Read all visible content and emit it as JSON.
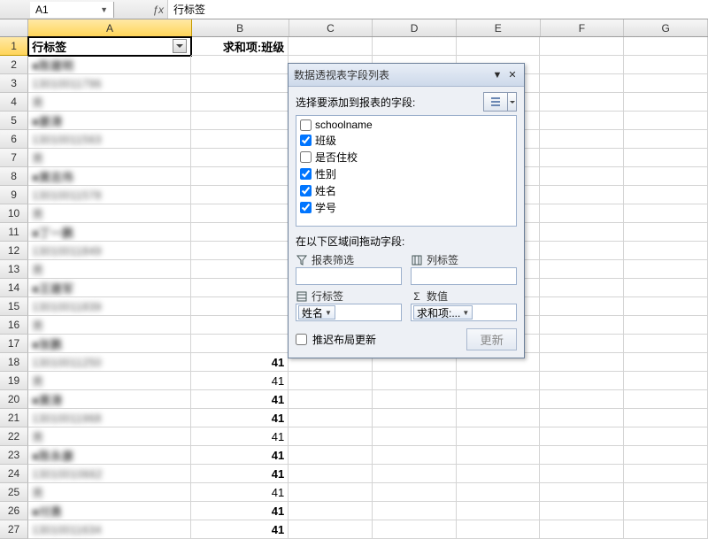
{
  "namebox": "A1",
  "formula": "行标签",
  "columns": [
    "A",
    "B",
    "C",
    "D",
    "E",
    "F",
    "G"
  ],
  "colWidths": {
    "A": 195,
    "B": 116,
    "C": 100,
    "D": 100,
    "E": 100,
    "F": 100,
    "G": 100
  },
  "rows": [
    {
      "n": 1,
      "a": "行标签",
      "aBold": true,
      "dd": true,
      "b": "求和项:班级",
      "bBold": true,
      "active": true
    },
    {
      "n": 2,
      "a": "■陈建明",
      "blur": true,
      "bold": true
    },
    {
      "n": 3,
      "a": "   13010011796",
      "blur": true
    },
    {
      "n": 4,
      "a": "      男",
      "blur": true
    },
    {
      "n": 5,
      "a": "■姜涛",
      "blur": true,
      "bold": true
    },
    {
      "n": 6,
      "a": "   13010011563",
      "blur": true
    },
    {
      "n": 7,
      "a": "      男",
      "blur": true
    },
    {
      "n": 8,
      "a": "■黄志伟",
      "blur": true,
      "bold": true
    },
    {
      "n": 9,
      "a": "   13010011578",
      "blur": true
    },
    {
      "n": 10,
      "a": "      男",
      "blur": true
    },
    {
      "n": 11,
      "a": "■丁一鹏",
      "blur": true,
      "bold": true
    },
    {
      "n": 12,
      "a": "   13010011849",
      "blur": true
    },
    {
      "n": 13,
      "a": "      男",
      "blur": true
    },
    {
      "n": 14,
      "a": "■王建军",
      "blur": true,
      "bold": true
    },
    {
      "n": 15,
      "a": "   13010011839",
      "blur": true
    },
    {
      "n": 16,
      "a": "      男",
      "blur": true
    },
    {
      "n": 17,
      "a": "■张鹏",
      "blur": true,
      "bold": true
    },
    {
      "n": 18,
      "a": "   13010011250",
      "blur": true,
      "b": "41",
      "bBold": true
    },
    {
      "n": 19,
      "a": "      男",
      "blur": true,
      "b": "41"
    },
    {
      "n": 20,
      "a": "■黄涛",
      "blur": true,
      "bold": true,
      "b": "41",
      "bBold": true
    },
    {
      "n": 21,
      "a": "   13010011968",
      "blur": true,
      "b": "41",
      "bBold": true
    },
    {
      "n": 22,
      "a": "      男",
      "blur": true,
      "b": "41"
    },
    {
      "n": 23,
      "a": "■陈永康",
      "blur": true,
      "bold": true,
      "b": "41",
      "bBold": true
    },
    {
      "n": 24,
      "a": "   13010010662",
      "blur": true,
      "b": "41",
      "bBold": true
    },
    {
      "n": 25,
      "a": "      男",
      "blur": true,
      "b": "41"
    },
    {
      "n": 26,
      "a": "■付勇",
      "blur": true,
      "bold": true,
      "b": "41",
      "bBold": true
    },
    {
      "n": 27,
      "a": "   13010011634",
      "blur": true,
      "b": "41",
      "bBold": true
    }
  ],
  "panel": {
    "title": "数据透视表字段列表",
    "chooseLabel": "选择要添加到报表的字段:",
    "fields": [
      {
        "label": "schoolname",
        "checked": false
      },
      {
        "label": "班级",
        "checked": true
      },
      {
        "label": "是否住校",
        "checked": false
      },
      {
        "label": "性别",
        "checked": true
      },
      {
        "label": "姓名",
        "checked": true
      },
      {
        "label": "学号",
        "checked": true
      }
    ],
    "areasLabel": "在以下区域间拖动字段:",
    "areaFilter": "报表筛选",
    "areaCols": "列标签",
    "areaRows": "行标签",
    "areaVals": "数值",
    "rowToken": "姓名",
    "valToken": "求和项:...",
    "deferLabel": "推迟布局更新",
    "updateBtn": "更新"
  }
}
